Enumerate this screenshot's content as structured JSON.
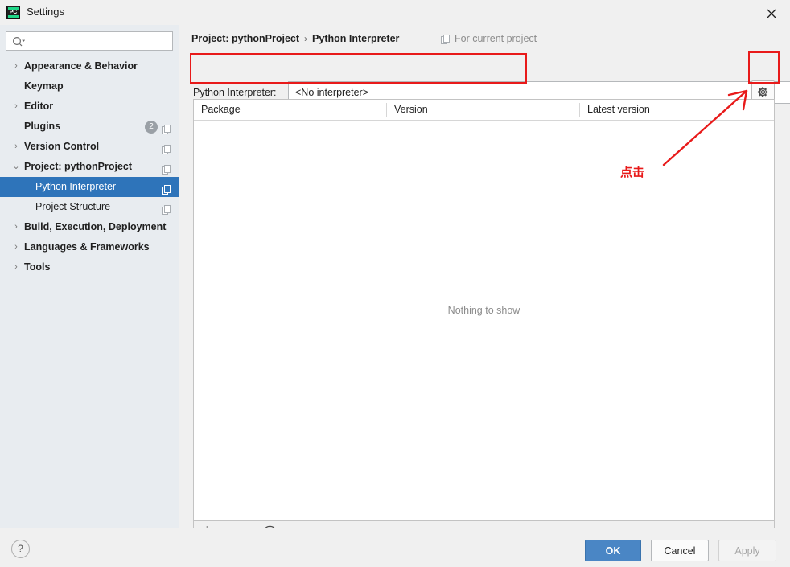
{
  "window": {
    "title": "Settings",
    "app_icon": "pycharm-icon",
    "close_icon": "close-icon"
  },
  "search": {
    "value": "",
    "placeholder": "",
    "icon": "search-icon"
  },
  "sidebar": {
    "items": [
      {
        "label": "Appearance & Behavior",
        "level": 0,
        "arrow": "›",
        "selected": false,
        "badge": null,
        "scope_icon": false
      },
      {
        "label": "Keymap",
        "level": 0,
        "arrow": "",
        "selected": false,
        "badge": null,
        "scope_icon": false
      },
      {
        "label": "Editor",
        "level": 0,
        "arrow": "›",
        "selected": false,
        "badge": null,
        "scope_icon": false
      },
      {
        "label": "Plugins",
        "level": 0,
        "arrow": "",
        "selected": false,
        "badge": "2",
        "scope_icon": true
      },
      {
        "label": "Version Control",
        "level": 0,
        "arrow": "›",
        "selected": false,
        "badge": null,
        "scope_icon": true
      },
      {
        "label": "Project: pythonProject",
        "level": 0,
        "arrow": "⌄",
        "selected": false,
        "badge": null,
        "scope_icon": true
      },
      {
        "label": "Python Interpreter",
        "level": 1,
        "arrow": "",
        "selected": true,
        "badge": null,
        "scope_icon": true
      },
      {
        "label": "Project Structure",
        "level": 1,
        "arrow": "",
        "selected": false,
        "badge": null,
        "scope_icon": true
      },
      {
        "label": "Build, Execution, Deployment",
        "level": 0,
        "arrow": "›",
        "selected": false,
        "badge": null,
        "scope_icon": false
      },
      {
        "label": "Languages & Frameworks",
        "level": 0,
        "arrow": "›",
        "selected": false,
        "badge": null,
        "scope_icon": false
      },
      {
        "label": "Tools",
        "level": 0,
        "arrow": "›",
        "selected": false,
        "badge": null,
        "scope_icon": false
      }
    ]
  },
  "breadcrumb": {
    "root": "Project: pythonProject",
    "separator": "›",
    "leaf": "Python Interpreter",
    "for_current_project": "For current project",
    "scope_icon": "project-scope-icon"
  },
  "interpreter": {
    "label": "Python Interpreter:",
    "value": "<No interpreter>",
    "dropdown_icon": "chevron-down-icon",
    "gear_icon": "gear-icon"
  },
  "packages": {
    "columns": [
      "Package",
      "Version",
      "Latest version"
    ],
    "rows": [],
    "empty_text": "Nothing to show",
    "toolbar": [
      {
        "name": "add-package-button",
        "glyph": "+"
      },
      {
        "name": "remove-package-button",
        "glyph": "−"
      },
      {
        "name": "upgrade-package-button",
        "glyph": "▲"
      },
      {
        "name": "show-early-releases-button",
        "glyph": "◉"
      }
    ]
  },
  "footer": {
    "help_label": "?",
    "ok_label": "OK",
    "cancel_label": "Cancel",
    "apply_label": "Apply"
  },
  "annotations": {
    "color": "#e81a1a",
    "click_text": "点击",
    "boxes": [
      "interpreter-field-highlight",
      "gear-button-highlight"
    ],
    "arrow": "arrow-to-gear-button"
  },
  "colors": {
    "selection_blue": "#2e74ba",
    "sidebar_bg": "#e8ecf0",
    "dialog_bg": "#f0f0f0",
    "primary_button": "#4a86c5",
    "annotation_red": "#e81a1a",
    "muted_text": "#8c8c8c"
  }
}
